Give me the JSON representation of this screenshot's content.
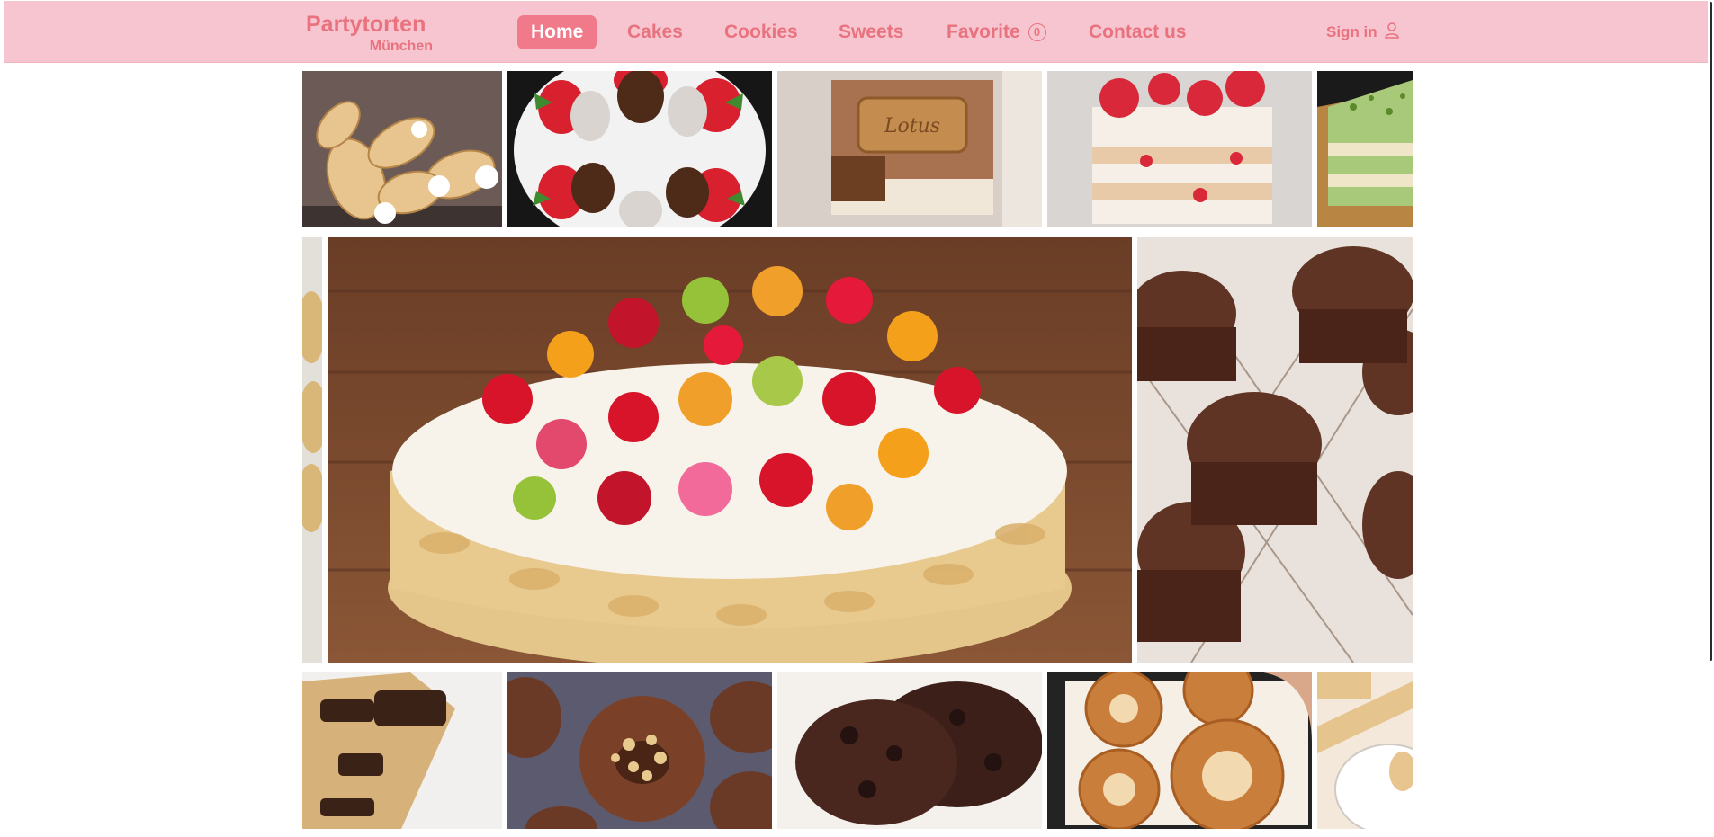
{
  "brand": {
    "name": "Partytorten",
    "city": "München"
  },
  "nav": {
    "home": "Home",
    "cakes": "Cakes",
    "cookies": "Cookies",
    "sweets": "Sweets",
    "favorite": "Favorite",
    "favorite_count": "0",
    "contact": "Contact us"
  },
  "signin": {
    "label": "Sign in",
    "icon": "user-icon"
  },
  "colors": {
    "navbar_bg": "#f7c5cf",
    "brand_pink": "#e9727f",
    "active_tab": "#f0798a"
  },
  "gallery": {
    "top_row": [
      "cream-horns",
      "chocolate-strawberries",
      "lotus-tiramisu",
      "strawberry-cake",
      "matcha-cake"
    ],
    "main_row": [
      "fruit-cake",
      "chocolate-muffins"
    ],
    "bottom_row": [
      "chocolate-chunk-cookie",
      "hazelnut-cookies",
      "double-chocolate-cookies",
      "sesame-pastries",
      "cream-cake"
    ]
  }
}
